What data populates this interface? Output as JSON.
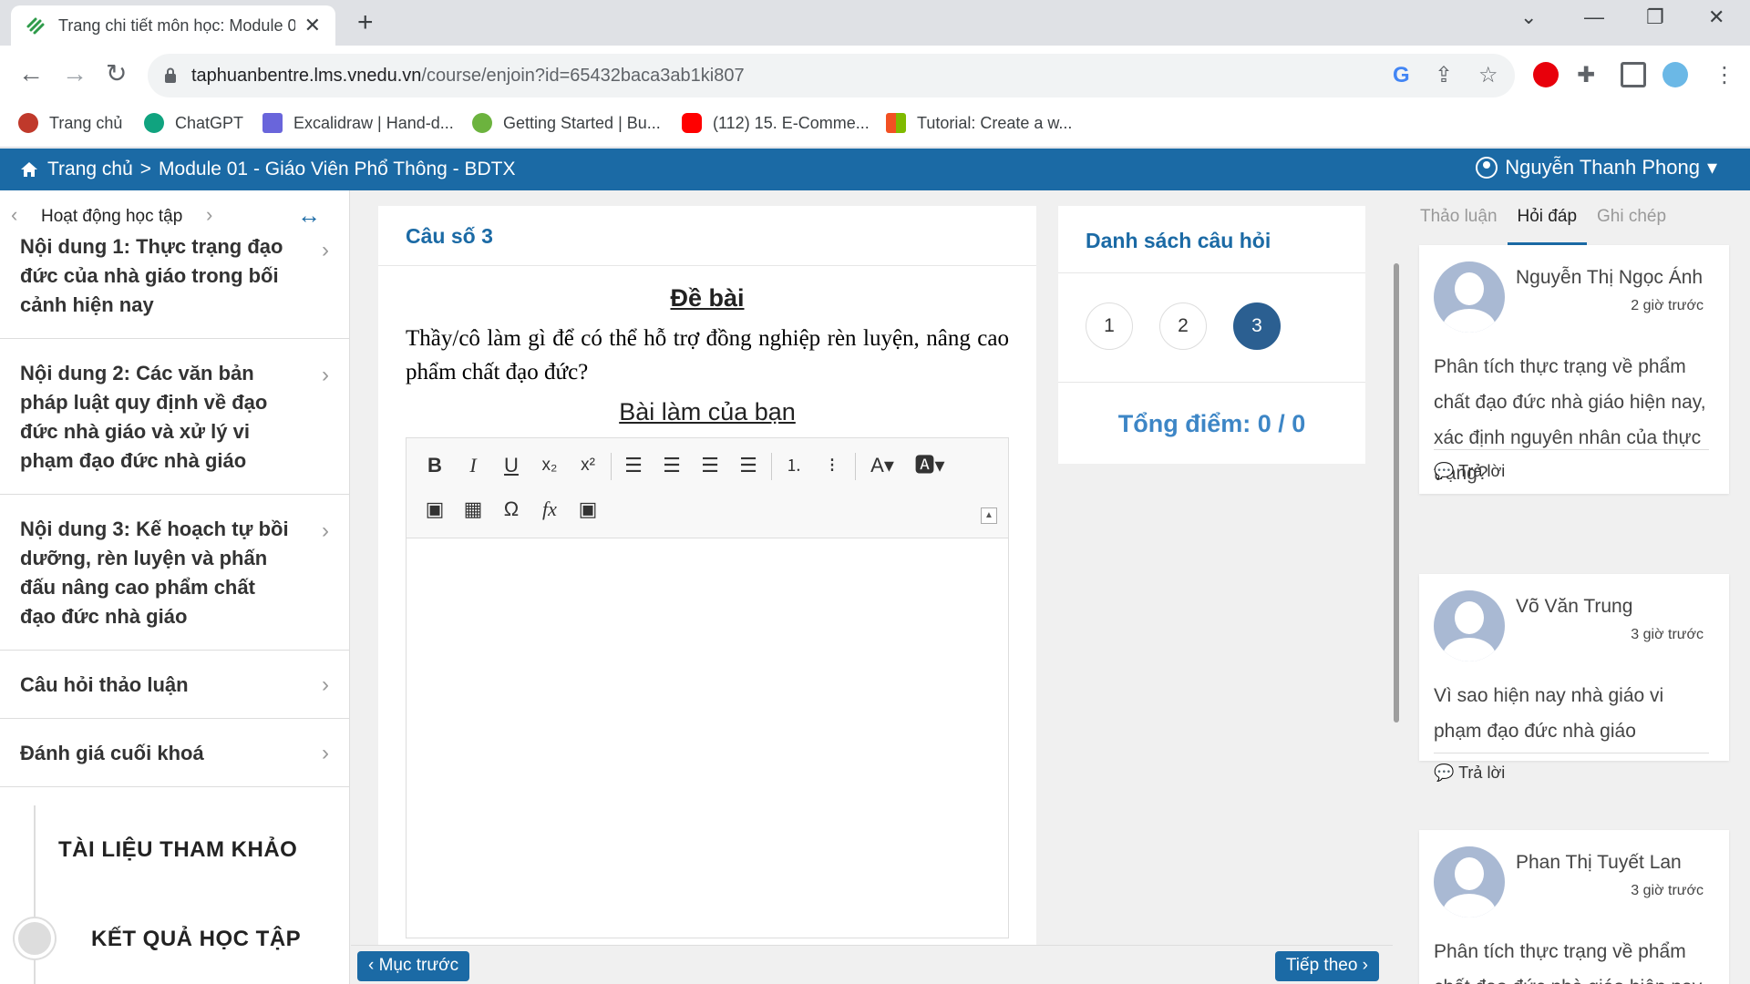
{
  "browser": {
    "tab_title": "Trang chi tiết môn học: Module 0",
    "url_host": "taphuanbentre.lms.vnedu.vn",
    "url_path": "/course/enjoin?id=65432baca3ab1ki807",
    "bookmarks": [
      {
        "label": "Trang chủ",
        "color": "#c0392b"
      },
      {
        "label": "ChatGPT",
        "color": "#10a37f"
      },
      {
        "label": "Excalidraw | Hand-d...",
        "color": "#6965db"
      },
      {
        "label": "Getting Started | Bu...",
        "color": "#6cb33e"
      },
      {
        "label": "(112) 15. E-Comme...",
        "color": "#ff0000"
      },
      {
        "label": "Tutorial: Create a w...",
        "color": "#f25022"
      }
    ]
  },
  "header": {
    "home": "Trang chủ",
    "sep": ">",
    "module": "Module 01 - Giáo Viên Phổ Thông - BDTX",
    "user": "Nguyễn Thanh Phong",
    "caret": "▾"
  },
  "sidebar": {
    "nav_label": "Hoạt động học tập",
    "items": [
      {
        "label": "Nội dung 1: Thực trạng đạo đức của nhà giáo trong bối cảnh hiện nay"
      },
      {
        "label": "Nội dung 2: Các văn bản pháp luật quy định về đạo đức nhà giáo và xử lý vi phạm đạo đức nhà giáo"
      },
      {
        "label": "Nội dung 3: Kế hoạch tự bồi dưỡng, rèn luyện và phấn đấu nâng cao phẩm chất đạo đức nhà giáo"
      },
      {
        "label": "Câu hỏi thảo luận"
      },
      {
        "label": "Đánh giá cuối khoá"
      }
    ],
    "section_ref": "TÀI LIỆU THAM KHẢO",
    "section_result": "KẾT QUẢ HỌC TẬP"
  },
  "question": {
    "title": "Câu số 3",
    "de_bai": "Đề bài",
    "text": "Thầy/cô làm gì để có thể hỗ trợ đồng nghiệp rèn luyện, nâng cao phẩm chất đạo đức?",
    "bai_lam": "Bài làm của bạn"
  },
  "question_list": {
    "title": "Danh sách câu hỏi",
    "numbers": [
      "1",
      "2",
      "3"
    ],
    "active": "3",
    "score": "Tổng điểm: 0 / 0"
  },
  "nav": {
    "prev": "‹ Mục trước",
    "next": "Tiếp theo ›"
  },
  "right_panel": {
    "tabs": [
      "Thảo luận",
      "Hỏi đáp",
      "Ghi chép"
    ],
    "active_tab": "Hỏi đáp",
    "reply_label": "Trả lời",
    "comments": [
      {
        "name": "Nguyễn Thị Ngọc Ánh",
        "time": "2 giờ trước",
        "text": "Phân tích thực trạng về phẩm chất đạo đức nhà giáo hiện nay, xác định nguyên nhân của thực trạng?"
      },
      {
        "name": "Võ Văn Trung",
        "time": "3 giờ trước",
        "text": "Vì sao hiện nay nhà giáo vi phạm đạo đức nhà giáo"
      },
      {
        "name": "Phan Thị Tuyết Lan",
        "time": "3 giờ trước",
        "text": "Phân tích thực trạng về phẩm chất đạo đức nhà giáo hiện nay"
      }
    ]
  },
  "colors": {
    "primary": "#1b6aa5",
    "active_number": "#2b5f91",
    "score": "#3d86c6"
  }
}
